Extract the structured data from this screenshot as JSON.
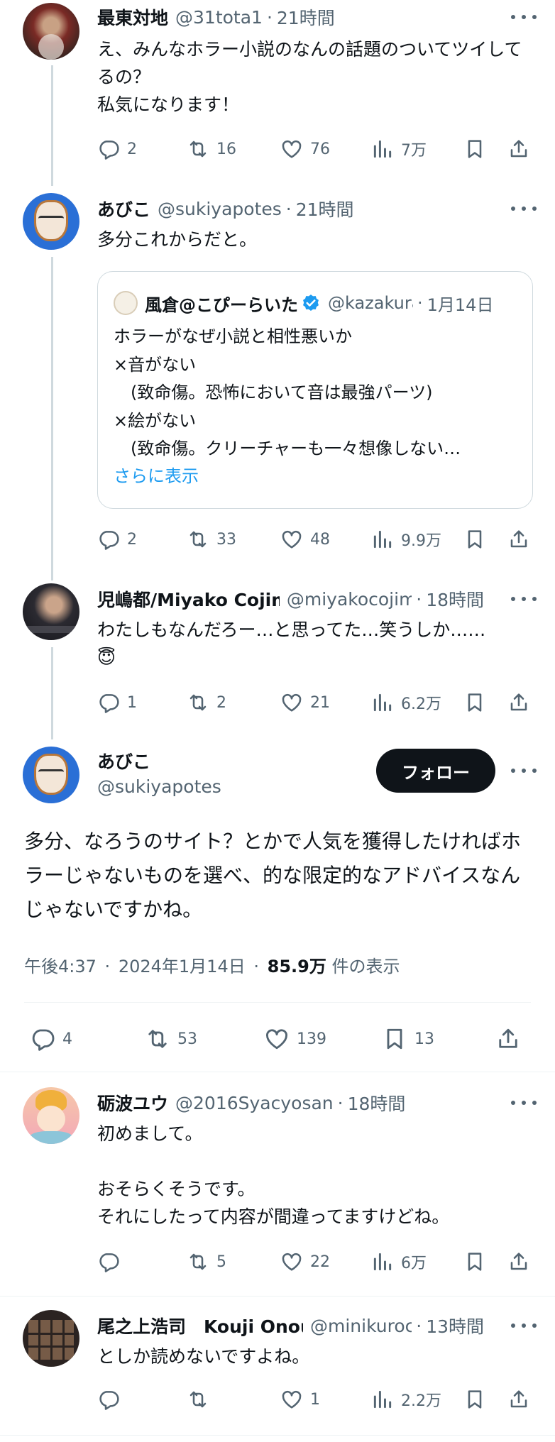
{
  "tweets": [
    {
      "name": "最東対地",
      "handle": "@31tota1",
      "sep": "·",
      "time": "21時間",
      "text": "え、みんなホラー小説のなんの話題のついてツイしてるの？\n私気になります！",
      "replies": "2",
      "retweets": "16",
      "likes": "76",
      "views": "7万"
    },
    {
      "name": "あびこ",
      "handle": "@sukiyapotes",
      "sep": "·",
      "time": "21時間",
      "text": "多分これからだと。",
      "replies": "2",
      "retweets": "33",
      "likes": "48",
      "views": "9.9万"
    },
    {
      "name": "児嶋都/Miyako Cojima",
      "handle": "@miyakocojima",
      "sep": "·",
      "time": "18時間",
      "text": "わたしもなんだろー…と思ってた…笑うしか……\n😇",
      "replies": "1",
      "retweets": "2",
      "likes": "21",
      "views": "6.2万"
    },
    {
      "name": "砺波ユウ",
      "handle": "@2016Syacyosan",
      "sep": "·",
      "time": "18時間",
      "text": "初めまして。\n\nおそらくそうです。\nそれにしたって内容が間違ってますけどね。",
      "replies": "",
      "retweets": "5",
      "likes": "22",
      "views": "6万"
    },
    {
      "name": "尾之上浩司　Kouji Onoue",
      "handle": "@minikuroc",
      "sep": "·",
      "time": "13時間",
      "text": "としか読めないですよね。",
      "replies": "",
      "retweets": "",
      "likes": "1",
      "views": "2.2万"
    }
  ],
  "quote": {
    "name": "風倉@こぴーらいた",
    "handle": "@kazakura",
    "sep": "·",
    "time": "1月14日",
    "text": "ホラーがなぜ小説と相性悪いか\n×音がない\n　(致命傷。恐怖において音は最強パーツ)\n×絵がない\n　(致命傷。クリーチャーも一々想像しない…",
    "show_more": "さらに表示"
  },
  "main": {
    "name": "あびこ",
    "handle": "@sukiyapotes",
    "follow_label": "フォロー",
    "text": "多分、なろうのサイト？とかで人気を獲得したければホラーじゃないものを選べ、的な限定的なアドバイスなんじゃないですかね。",
    "time": "午後4:37",
    "date_sep": "·",
    "date": "2024年1月14日",
    "views_sep": "·",
    "views": "85.9万",
    "views_label": "件の表示",
    "replies": "4",
    "retweets": "53",
    "likes": "139",
    "bookmarks": "13"
  },
  "icons": [
    "reply-icon",
    "retweet-icon",
    "like-icon",
    "views-icon",
    "bookmark-icon",
    "share-icon",
    "more-icon",
    "verified-icon"
  ],
  "colors": {
    "text": "#0f1419",
    "secondary": "#536471",
    "accent": "#1d9bf0",
    "line": "#cfd9de",
    "button": "#0f1419"
  }
}
